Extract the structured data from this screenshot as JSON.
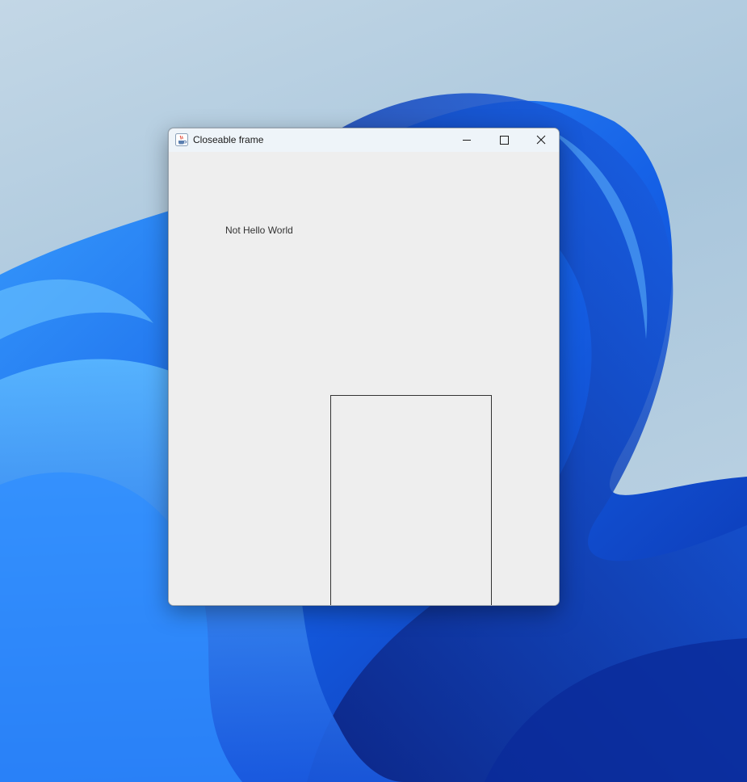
{
  "window": {
    "title": "Closeable frame",
    "app_icon": "java-cup-icon",
    "controls": {
      "minimize_icon": "minimize-icon",
      "maximize_icon": "maximize-icon",
      "close_icon": "close-icon"
    }
  },
  "content": {
    "label_text": "Not Hello World"
  },
  "colors": {
    "titlebar": "#eef4f9",
    "content_background": "#eeeeee",
    "label_text": "#333333",
    "box_border": "#333333",
    "wallpaper_blue": "#1565e8"
  }
}
